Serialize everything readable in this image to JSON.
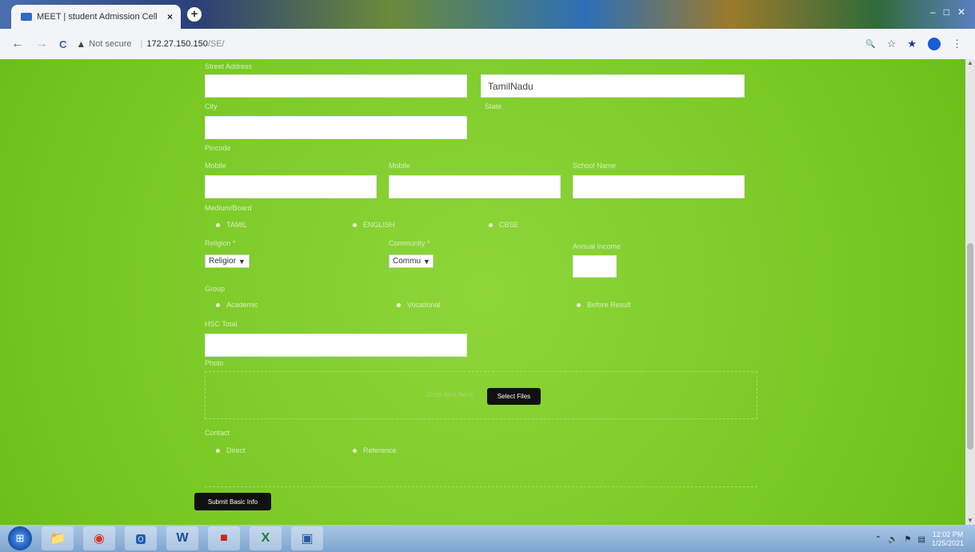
{
  "browser": {
    "tab_title": "MEET | student Admission Cell",
    "close_label": "×",
    "new_tab_label": "+",
    "back_label": "←",
    "forward_label": "→",
    "reload_label": "C",
    "warning_icon_label": "▲",
    "not_secure_label": "Not secure",
    "url_host": "172.27.150.150",
    "url_path": "/SE/",
    "window_controls": [
      "–",
      "□",
      "✕"
    ],
    "zoom_icon_label": "🔍",
    "star_icon_label": "☆",
    "ext_icon_label": "★",
    "menu_icon_label": "⋮"
  },
  "form": {
    "street_label": "Street Address",
    "street_value": "",
    "city_label": "City",
    "city_value": "",
    "state_label": "State",
    "state_value": "TamilNadu",
    "pincode_label": "Pincode",
    "pincode_value": "",
    "mobile1_label": "Mobile",
    "mobile1_value": "",
    "mobile2_label": "Mobile",
    "mobile2_value": "",
    "school_label": "School Name",
    "school_value": "",
    "medium_label": "Medium/Board",
    "medium_options": [
      "TAMIL",
      "ENGLISH",
      "CBSE"
    ],
    "religion_label": "Religion *",
    "religion_value": "Religior",
    "community_label": "Community *",
    "community_value": "Commu",
    "income_label": "Annual Income",
    "income_value": "",
    "group_label": "Group",
    "group_options": [
      "Academic",
      "Vocational",
      "Before Result"
    ],
    "hsc_label": "HSC Total",
    "hsc_value": "",
    "photo_label": "Photo",
    "drop_text": "Drop files here",
    "select_files_label": "Select Files",
    "contact_label": "Contact",
    "contact_options": [
      "Direct",
      "Reference"
    ],
    "submit_label": "Submit Basic Info"
  },
  "taskbar": {
    "start_label": "⊞",
    "apps": [
      "📁",
      "◉",
      "🅾",
      "W",
      "■",
      "X",
      "▣"
    ],
    "tray_icons": [
      "⌃",
      "🔊",
      "⚑",
      "▤"
    ],
    "time": "12:02 PM",
    "date": "1/25/2021"
  },
  "colors": {
    "page_bg": "#7fcf2a",
    "button_bg": "#111111"
  }
}
